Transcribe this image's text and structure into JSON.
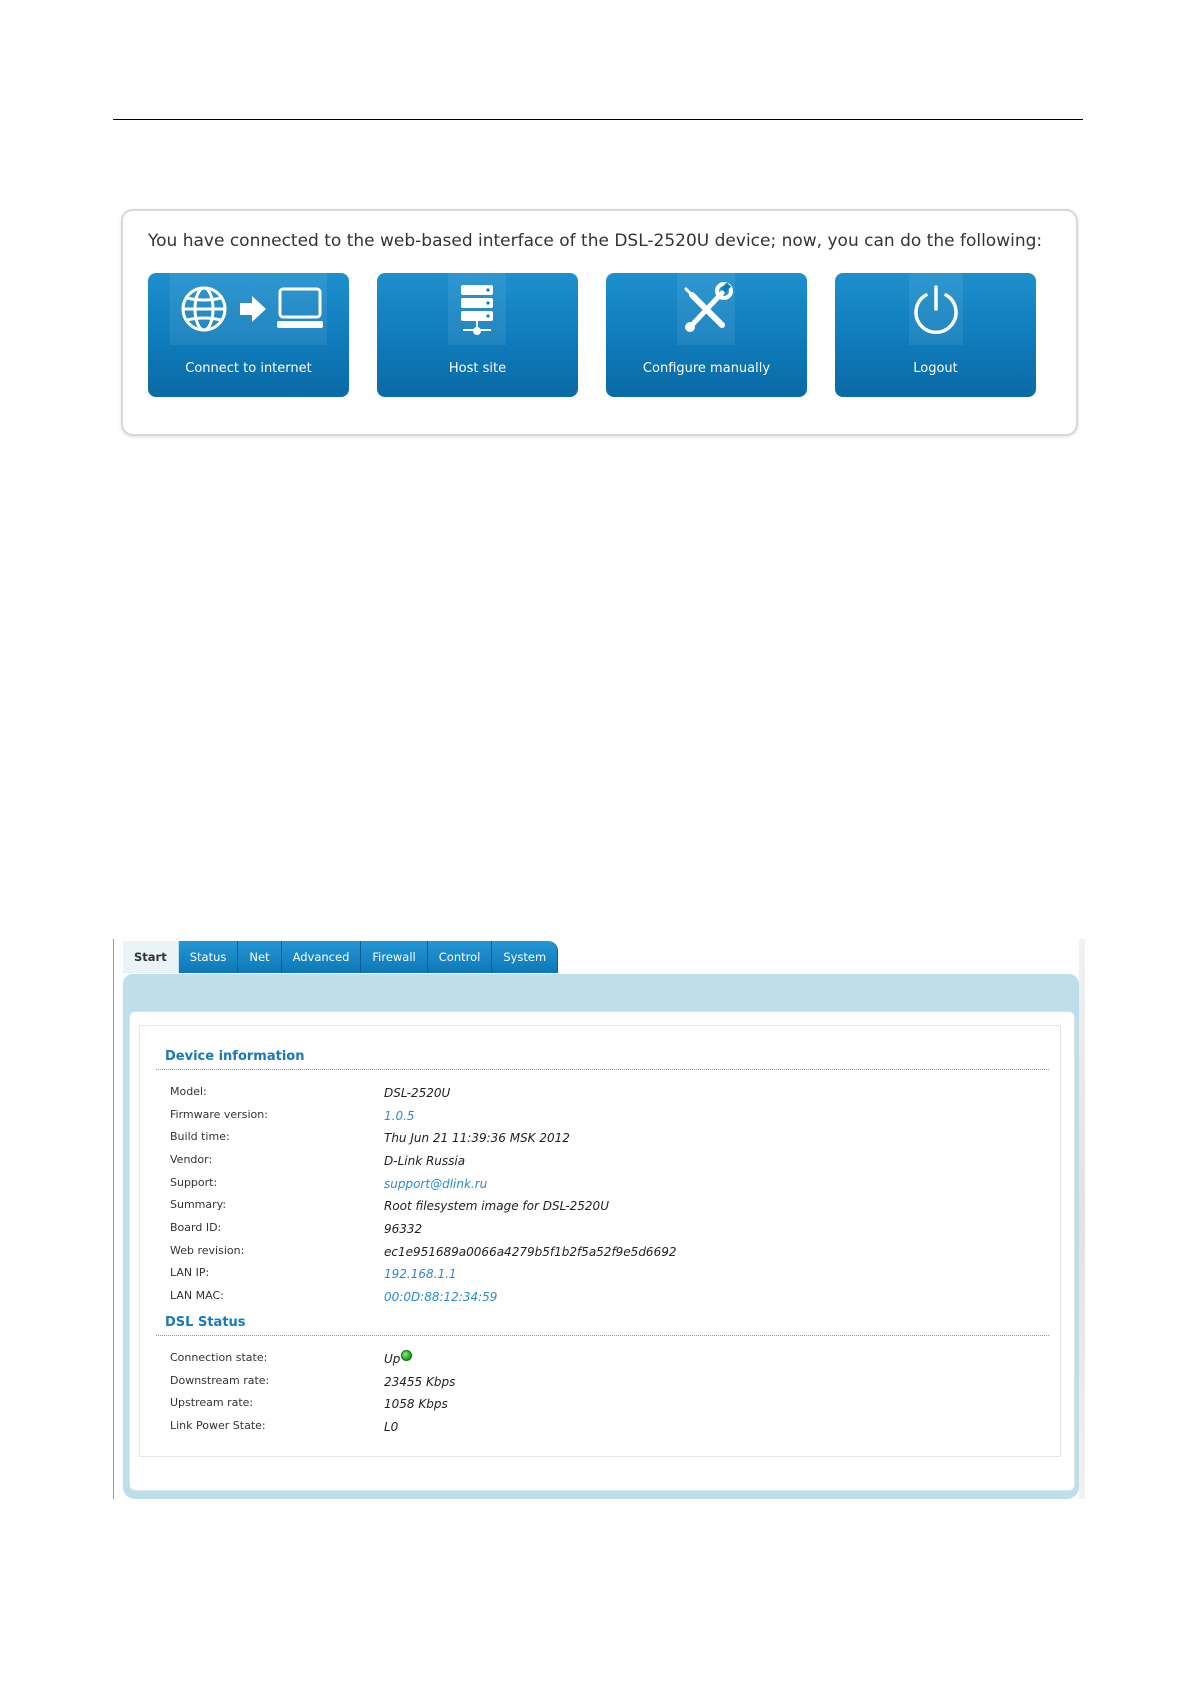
{
  "welcome": {
    "message": "You have connected to the web-based interface of the DSL-2520U device; now, you can do the following:",
    "tiles": [
      {
        "label": "Connect to internet",
        "icon": "globe-arrow-computer-icon"
      },
      {
        "label": "Host site",
        "icon": "server-icon"
      },
      {
        "label": "Configure manually",
        "icon": "wrench-screwdriver-icon"
      },
      {
        "label": "Logout",
        "icon": "power-icon"
      }
    ]
  },
  "router": {
    "tabs": [
      "Start",
      "Status",
      "Net",
      "Advanced",
      "Firewall",
      "Control",
      "System"
    ],
    "active_tab": "Start",
    "device_info": {
      "title": "Device information",
      "rows": [
        {
          "label": "Model:",
          "value": "DSL-2520U"
        },
        {
          "label": "Firmware version:",
          "value": "1.0.5"
        },
        {
          "label": "Build time:",
          "value": "Thu Jun 21 11:39:36 MSK 2012"
        },
        {
          "label": "Vendor:",
          "value": "D-Link Russia"
        },
        {
          "label": "Support:",
          "value": "support@dlink.ru"
        },
        {
          "label": "Summary:",
          "value": "Root filesystem image for DSL-2520U"
        },
        {
          "label": "Board ID:",
          "value": "96332"
        },
        {
          "label": "Web revision:",
          "value": "ec1e951689a0066a4279b5f1b2f5a52f9e5d6692"
        },
        {
          "label": "LAN IP:",
          "value": "192.168.1.1"
        },
        {
          "label": "LAN MAC:",
          "value": "00:0D:88:12:34:59"
        }
      ]
    },
    "dsl_status": {
      "title": "DSL Status",
      "rows": [
        {
          "label": "Connection state:",
          "value": "Up"
        },
        {
          "label": "Downstream rate:",
          "value": "23455 Kbps"
        },
        {
          "label": "Upstream rate:",
          "value": "1058 Kbps"
        },
        {
          "label": "Link Power State:",
          "value": "L0"
        }
      ]
    }
  },
  "colors": {
    "tile_blue": "#0f7bbb",
    "tab_blue": "#1787c8",
    "section_title": "#1779bd",
    "link": "#2a8bd0",
    "status_green": "#1c9b1c"
  }
}
